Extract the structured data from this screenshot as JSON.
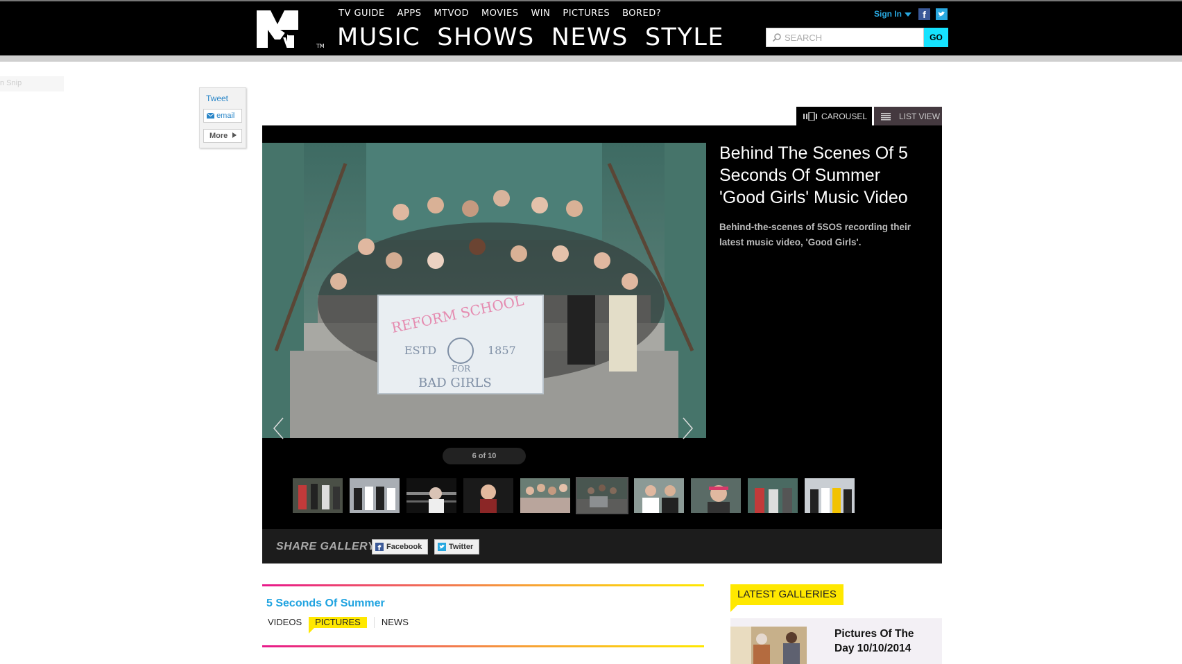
{
  "header": {
    "subnav": [
      "TV GUIDE",
      "APPS",
      "MTVOD",
      "MOVIES",
      "WIN",
      "PICTURES",
      "BORED?"
    ],
    "mainnav": [
      "MUSIC",
      "SHOWS",
      "NEWS",
      "STYLE"
    ],
    "signin": "Sign In",
    "search_placeholder": "SEARCH",
    "go_label": "GO",
    "facebook_icon": "f"
  },
  "snip_label": "n Snip",
  "share_widget": {
    "tweet": "Tweet",
    "email": "email",
    "more": "More"
  },
  "view_tabs": {
    "carousel": "CAROUSEL",
    "list": "LIST VIEW"
  },
  "gallery": {
    "title": "Behind The Scenes Of 5 Seconds Of Summer 'Good Girls' Music Video",
    "description": "Behind-the-scenes of 5SOS recording their latest music video, 'Good Girls'.",
    "counter": "6 of 10",
    "sign_lines": [
      "REFORM SCHOOL",
      "ESTD",
      "1857",
      "FOR",
      "BAD GIRLS"
    ],
    "thumbnail_count": 10,
    "active_thumbnail": 6
  },
  "share_gallery": {
    "label": "SHARE GALLERY",
    "facebook": "Facebook",
    "twitter": "Twitter"
  },
  "artist": {
    "name": "5 Seconds Of Summer",
    "tabs": [
      "VIDEOS",
      "PICTURES",
      "NEWS"
    ],
    "active_tab": "PICTURES"
  },
  "latest": {
    "label": "LATEST GALLERIES",
    "item_title": "Pictures Of The Day 10/10/2014"
  },
  "colors": {
    "accent_cyan": "#16e3ff",
    "highlight_yellow": "#ffe800",
    "link_blue": "#1fa3e0"
  }
}
